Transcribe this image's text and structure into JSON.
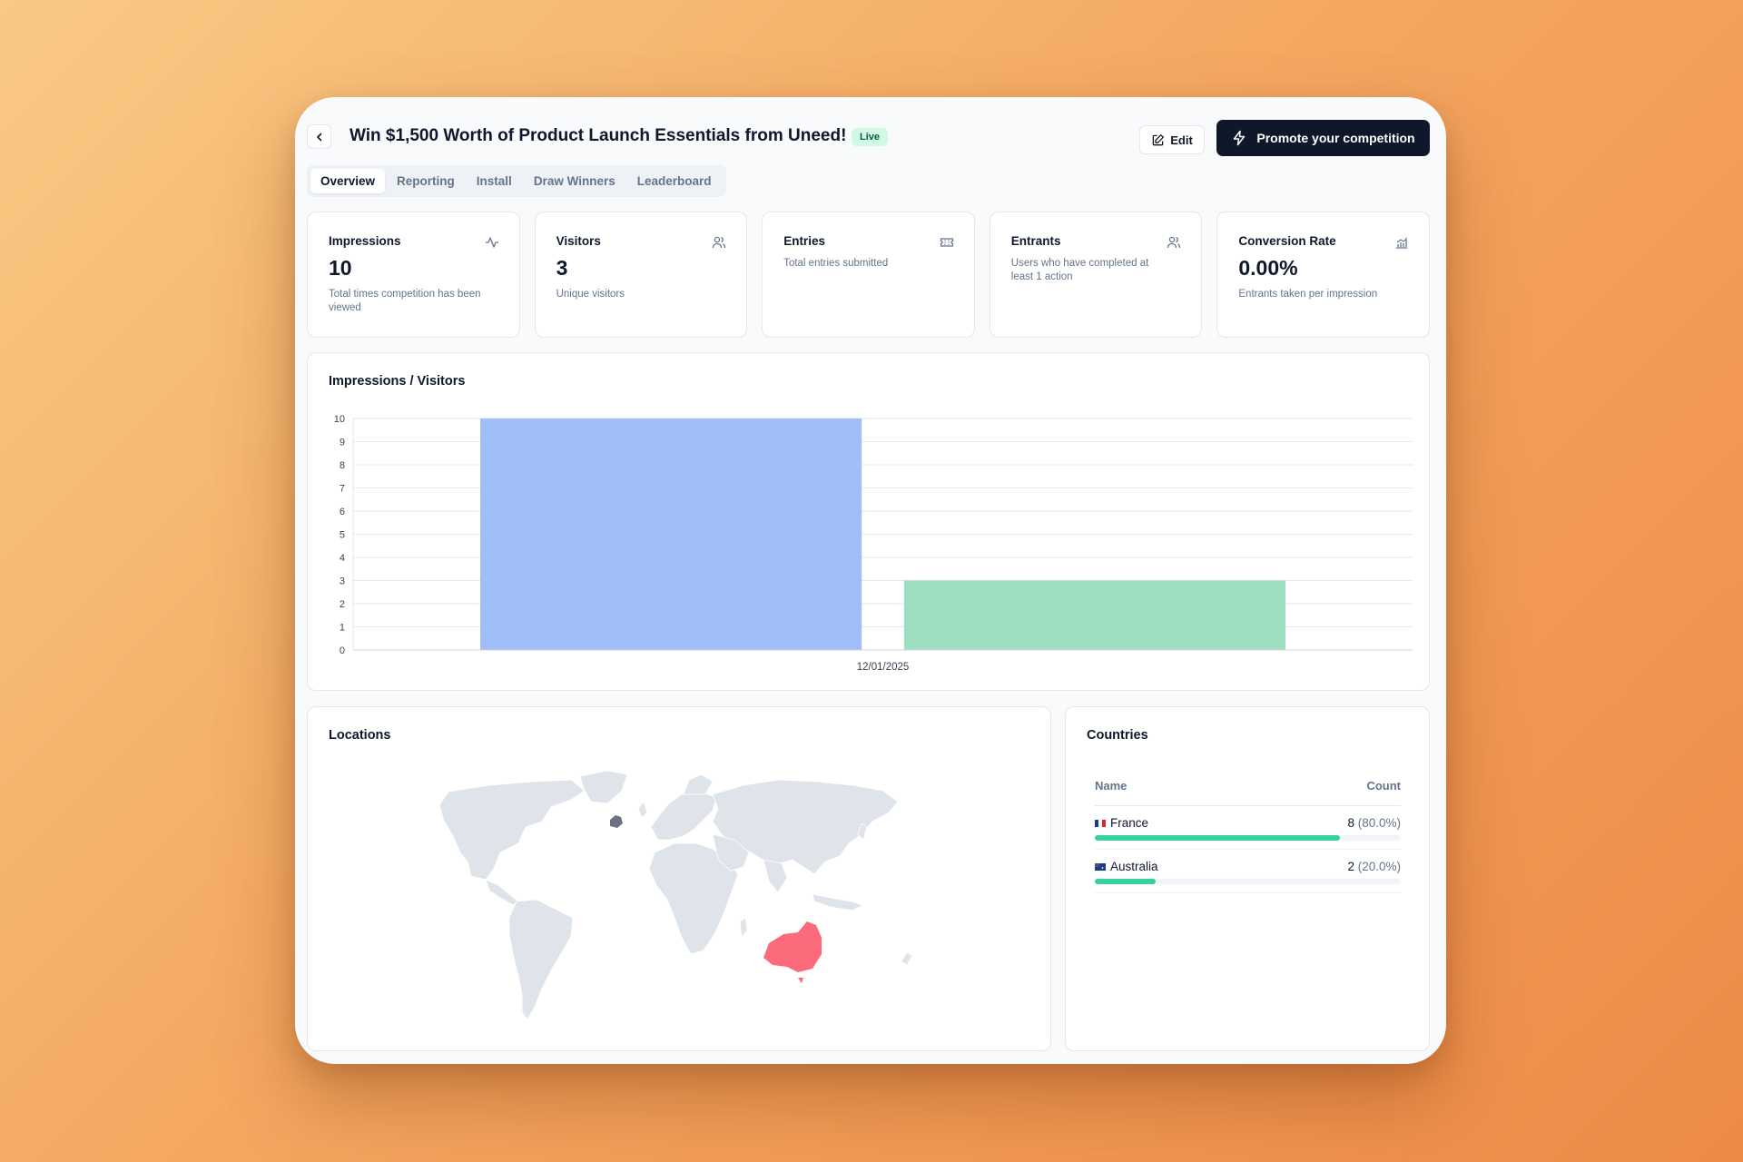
{
  "header": {
    "title": "Win $1,500 Worth of Product Launch Essentials from Uneed!",
    "status_badge": "Live",
    "edit_label": "Edit",
    "promote_label": "Promote your competition"
  },
  "tabs": [
    {
      "label": "Overview",
      "active": true
    },
    {
      "label": "Reporting",
      "active": false
    },
    {
      "label": "Install",
      "active": false
    },
    {
      "label": "Draw Winners",
      "active": false
    },
    {
      "label": "Leaderboard",
      "active": false
    }
  ],
  "stats": [
    {
      "label": "Impressions",
      "value": "10",
      "description": "Total times competition has been viewed",
      "icon": "activity-icon"
    },
    {
      "label": "Visitors",
      "value": "3",
      "description": "Unique visitors",
      "icon": "users-icon"
    },
    {
      "label": "Entries",
      "value": "",
      "description": "Total entries submitted",
      "icon": "ticket-icon"
    },
    {
      "label": "Entrants",
      "value": "",
      "description": "Users who have completed at least 1 action",
      "icon": "users-icon"
    },
    {
      "label": "Conversion Rate",
      "value": "0.00%",
      "description": "Entrants taken per impression",
      "icon": "chart-icon"
    }
  ],
  "chart_panel": {
    "title": "Impressions / Visitors"
  },
  "chart_data": {
    "type": "bar",
    "categories": [
      "12/01/2025"
    ],
    "series": [
      {
        "name": "",
        "values": [
          10
        ],
        "color": "#a0bff8"
      },
      {
        "name": "",
        "values": [
          3
        ],
        "color": "#9ddfc0"
      }
    ],
    "yticks": [
      "0",
      "1",
      "2",
      "3",
      "4",
      "5",
      "6",
      "7",
      "8",
      "9",
      "10"
    ],
    "ylim": [
      0,
      10
    ],
    "grid": true
  },
  "locations": {
    "title": "Locations",
    "colors": {
      "land": "#dfe4eb",
      "france": "#6b7280",
      "australia": "#fb6a7a"
    }
  },
  "countries": {
    "title": "Countries",
    "col_name": "Name",
    "col_count": "Count",
    "rows": [
      {
        "name": "France",
        "count": "8",
        "pct": "(80.0%)",
        "share": 0.8
      },
      {
        "name": "Australia",
        "count": "2",
        "pct": "(20.0%)",
        "share": 0.2
      }
    ]
  }
}
